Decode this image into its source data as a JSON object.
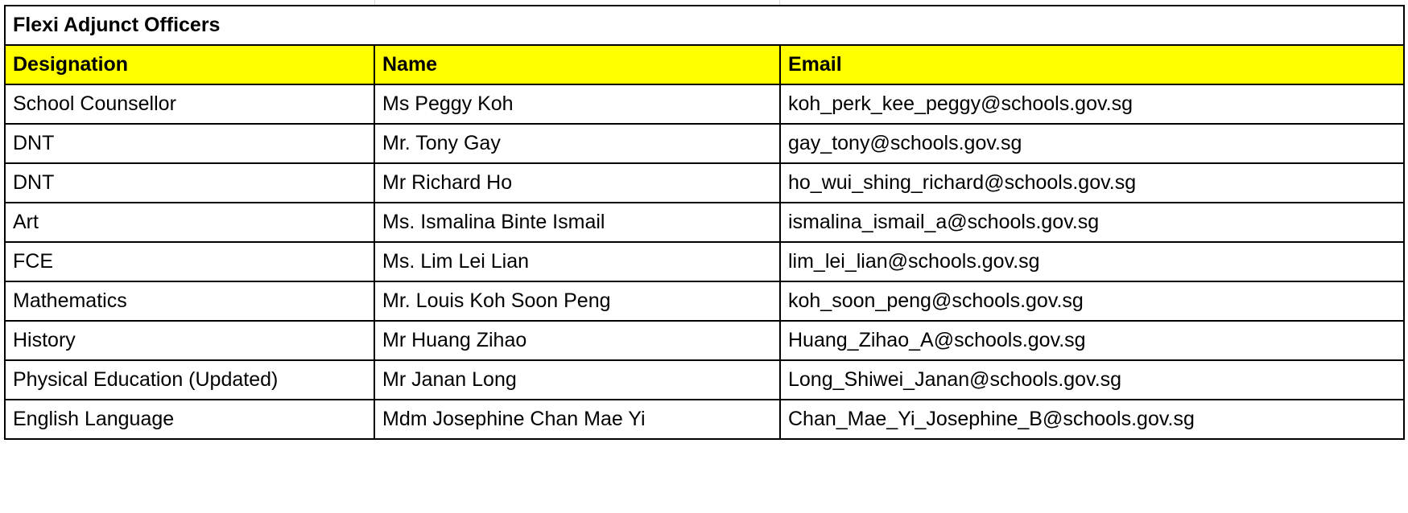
{
  "table": {
    "title": "Flexi Adjunct Officers",
    "header_color": "#ffff00",
    "columns": [
      "Designation",
      "Name",
      "Email"
    ],
    "rows": [
      [
        "School Counsellor",
        "Ms Peggy Koh",
        "koh_perk_kee_peggy@schools.gov.sg"
      ],
      [
        "DNT",
        "Mr. Tony Gay",
        "gay_tony@schools.gov.sg"
      ],
      [
        "DNT",
        "Mr Richard Ho",
        "ho_wui_shing_richard@schools.gov.sg"
      ],
      [
        "Art",
        "Ms. Ismalina Binte Ismail",
        "ismalina_ismail_a@schools.gov.sg"
      ],
      [
        "FCE",
        "Ms. Lim Lei Lian",
        "lim_lei_lian@schools.gov.sg"
      ],
      [
        "Mathematics",
        "Mr. Louis Koh Soon Peng",
        "koh_soon_peng@schools.gov.sg"
      ],
      [
        "History",
        "Mr Huang Zihao",
        "Huang_Zihao_A@schools.gov.sg"
      ],
      [
        "Physical Education (Updated)",
        "Mr Janan Long",
        "Long_Shiwei_Janan@schools.gov.sg"
      ],
      [
        "English Language",
        "Mdm Josephine Chan Mae Yi",
        "Chan_Mae_Yi_Josephine_B@schools.gov.sg"
      ]
    ]
  }
}
